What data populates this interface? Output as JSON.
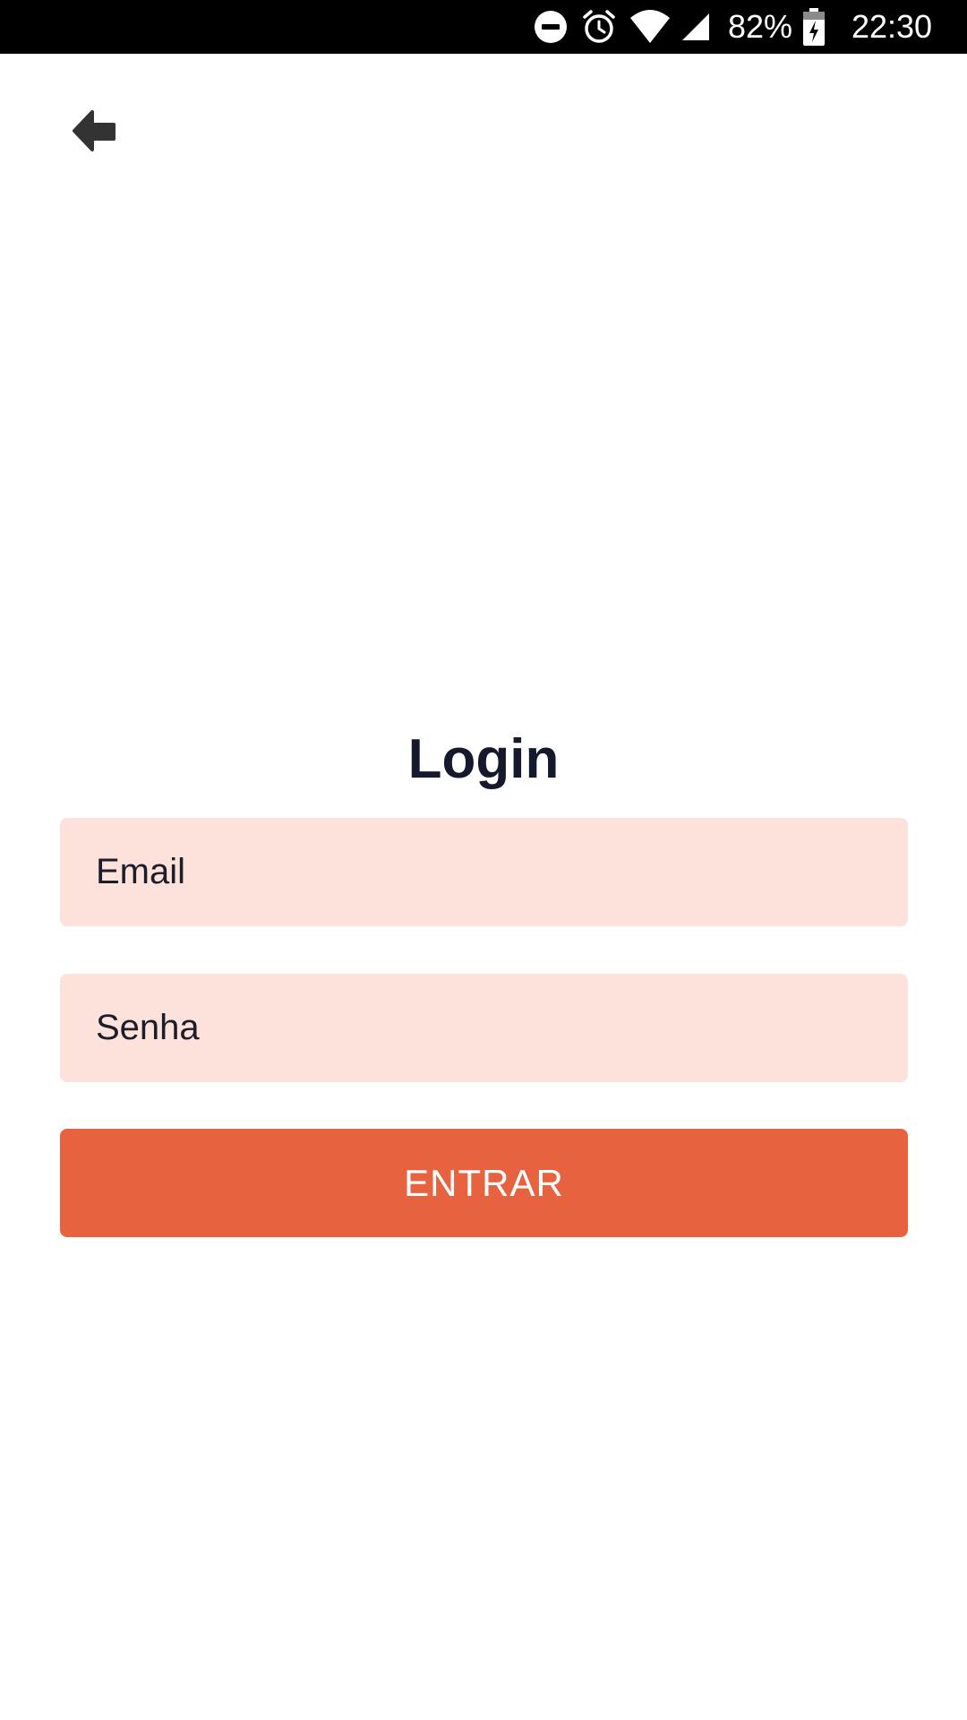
{
  "status_bar": {
    "battery_percent": "82%",
    "time": "22:30",
    "icons": [
      "do-not-disturb-icon",
      "alarm-icon",
      "wifi-icon",
      "cell-signal-icon",
      "battery-charging-icon"
    ]
  },
  "header": {
    "back_icon": "back-arrow-icon"
  },
  "login": {
    "title": "Login",
    "email_placeholder": "Email",
    "password_placeholder": "Senha",
    "submit_label": "ENTRAR"
  },
  "colors": {
    "accent": "#e76340",
    "field_background": "#fde1db",
    "title_text": "#141a2c",
    "status_bar": "#000000"
  }
}
